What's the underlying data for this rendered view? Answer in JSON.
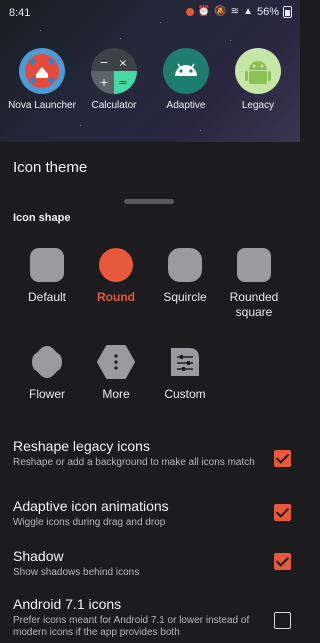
{
  "status": {
    "time": "8:41",
    "battery": "56%"
  },
  "apps": [
    {
      "label": "Nova Launcher",
      "icon": "nova-launcher-icon"
    },
    {
      "label": "Calculator",
      "icon": "calculator-icon"
    },
    {
      "label": "Adaptive",
      "icon": "android-adaptive-icon"
    },
    {
      "label": "Legacy",
      "icon": "android-legacy-icon"
    }
  ],
  "sheet": {
    "title": "Icon theme",
    "section": "Icon shape",
    "shapes": [
      {
        "label": "Default"
      },
      {
        "label": "Round",
        "selected": true
      },
      {
        "label": "Squircle"
      },
      {
        "label": "Rounded square"
      },
      {
        "label": "Flower"
      },
      {
        "label": "More"
      },
      {
        "label": "Custom"
      }
    ],
    "settings": [
      {
        "title": "Reshape legacy icons",
        "desc": "Reshape or add a background to make all icons match",
        "checked": true
      },
      {
        "title": "Adaptive icon animations",
        "desc": "Wiggle icons during drag and drop",
        "checked": true
      },
      {
        "title": "Shadow",
        "desc": "Show shadows behind icons",
        "checked": true
      },
      {
        "title": "Android 7.1 icons",
        "desc": "Prefer icons meant for Android 7.1 or lower instead of modern icons if the app provides both",
        "checked": false
      }
    ]
  },
  "colors": {
    "accent": "#e8583a",
    "background": "#1c1c1e"
  }
}
